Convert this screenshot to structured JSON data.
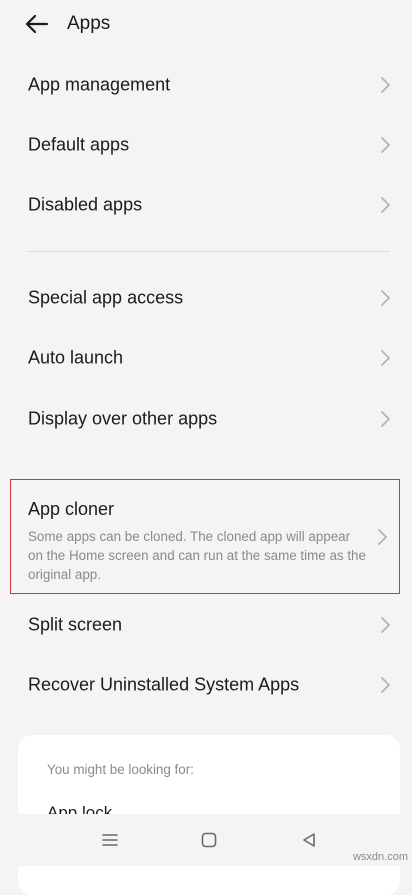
{
  "header": {
    "back_icon": "arrow-left-icon",
    "title": "Apps"
  },
  "menu": {
    "group1": [
      {
        "label": "App management"
      },
      {
        "label": "Default apps"
      },
      {
        "label": "Disabled apps"
      }
    ],
    "group2": [
      {
        "label": "Special app access"
      },
      {
        "label": "Auto launch"
      },
      {
        "label": "Display over other apps"
      }
    ],
    "app_cloner": {
      "title": "App cloner",
      "description": "Some apps can be cloned. The cloned app will appear on the Home screen and can run at the same time as the original app.",
      "highlight_color": "#d6313a"
    },
    "group3": [
      {
        "label": "Split screen"
      },
      {
        "label": "Recover Uninstalled System Apps"
      }
    ]
  },
  "suggestions": {
    "heading": "You might be looking for:",
    "items": [
      {
        "label": "App lock"
      }
    ]
  },
  "navbar": {
    "icons": [
      "menu-icon",
      "home-icon",
      "back-triangle-icon"
    ]
  },
  "watermark": "wsxdn.com",
  "colors": {
    "background": "#f4f4f5",
    "text_primary": "#1b1b1b",
    "text_secondary": "#8a8a8a",
    "chevron": "#b4b4b6"
  }
}
